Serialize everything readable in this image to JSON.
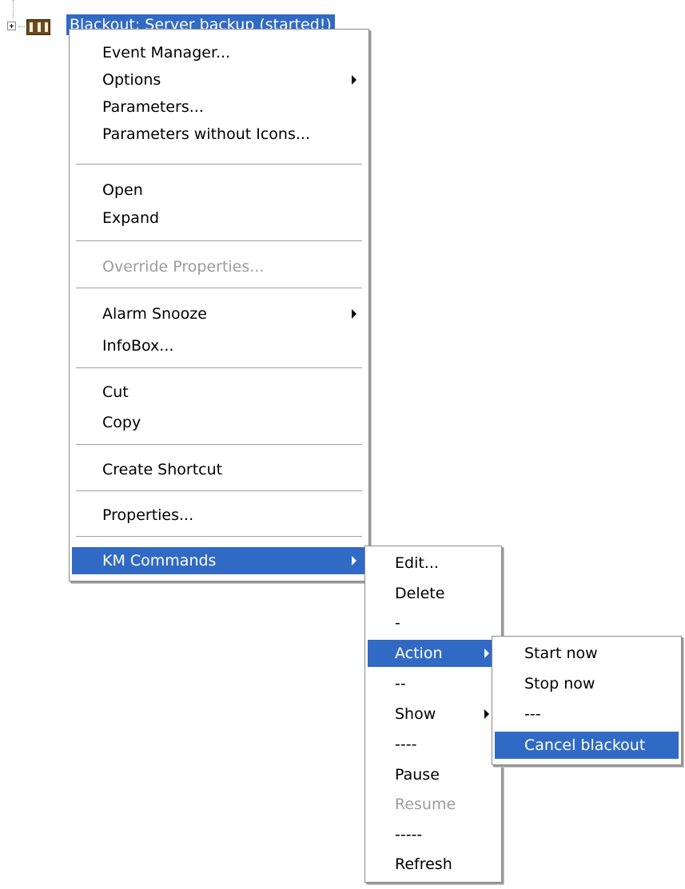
{
  "tree_node": {
    "label": "Blackout: Server backup (started!)",
    "icon": "blackout-node-icon"
  },
  "main_menu": {
    "items": [
      {
        "label": "Event Manager..."
      },
      {
        "label": "Options",
        "submenu": true
      },
      {
        "label": "Parameters..."
      },
      {
        "label": "Parameters without Icons..."
      },
      {
        "label": "Open"
      },
      {
        "label": "Expand"
      },
      {
        "label": "Override Properties...",
        "disabled": true
      },
      {
        "label": "Alarm Snooze",
        "submenu": true
      },
      {
        "label": "InfoBox..."
      },
      {
        "label": "Cut"
      },
      {
        "label": "Copy"
      },
      {
        "label": "Create Shortcut"
      },
      {
        "label": "Properties..."
      },
      {
        "label": "KM Commands",
        "submenu": true,
        "selected": true
      }
    ]
  },
  "km_menu": {
    "items": [
      {
        "label": "Edit..."
      },
      {
        "label": "Delete"
      },
      {
        "label": "-"
      },
      {
        "label": "Action",
        "submenu": true,
        "selected": true
      },
      {
        "label": "--"
      },
      {
        "label": "Show",
        "submenu": true
      },
      {
        "label": "----"
      },
      {
        "label": "Pause"
      },
      {
        "label": "Resume",
        "disabled": true
      },
      {
        "label": "-----"
      },
      {
        "label": "Refresh"
      }
    ]
  },
  "action_menu": {
    "items": [
      {
        "label": "Start now"
      },
      {
        "label": "Stop now"
      },
      {
        "label": "---"
      },
      {
        "label": "Cancel blackout",
        "selected": true
      }
    ]
  },
  "colors": {
    "highlight": "#316ac5",
    "disabled_text": "#9c9c9c",
    "node_icon": "#6b4a1e"
  }
}
